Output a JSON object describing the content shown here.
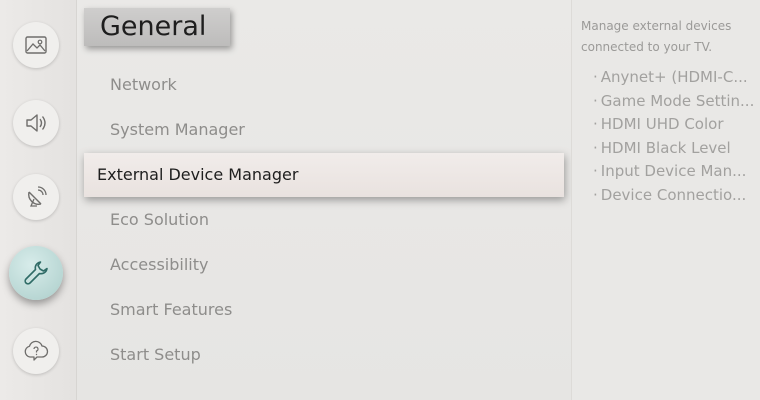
{
  "title": "General",
  "menu": [
    {
      "label": "Network"
    },
    {
      "label": "System Manager"
    },
    {
      "label": "External Device Manager"
    },
    {
      "label": "Eco Solution"
    },
    {
      "label": "Accessibility"
    },
    {
      "label": "Smart Features"
    },
    {
      "label": "Start Setup"
    }
  ],
  "selected_index": 2,
  "description": "Manage external devices connected to your TV.",
  "sub_items": [
    {
      "label": "Anynet+ (HDMI-C..."
    },
    {
      "label": "Game Mode Settin..."
    },
    {
      "label": "HDMI UHD Color"
    },
    {
      "label": "HDMI Black Level"
    },
    {
      "label": "Input Device Man..."
    },
    {
      "label": "Device Connectio..."
    }
  ],
  "sidebar": [
    {
      "icon": "picture-icon"
    },
    {
      "icon": "sound-icon"
    },
    {
      "icon": "broadcast-icon"
    },
    {
      "icon": "wrench-icon",
      "active": true
    },
    {
      "icon": "support-icon"
    }
  ],
  "colors": {
    "accent": "#b9d7d4",
    "text_active": "#1e1e1e",
    "text_dim": "#8e8d8b"
  },
  "bullet": "·"
}
